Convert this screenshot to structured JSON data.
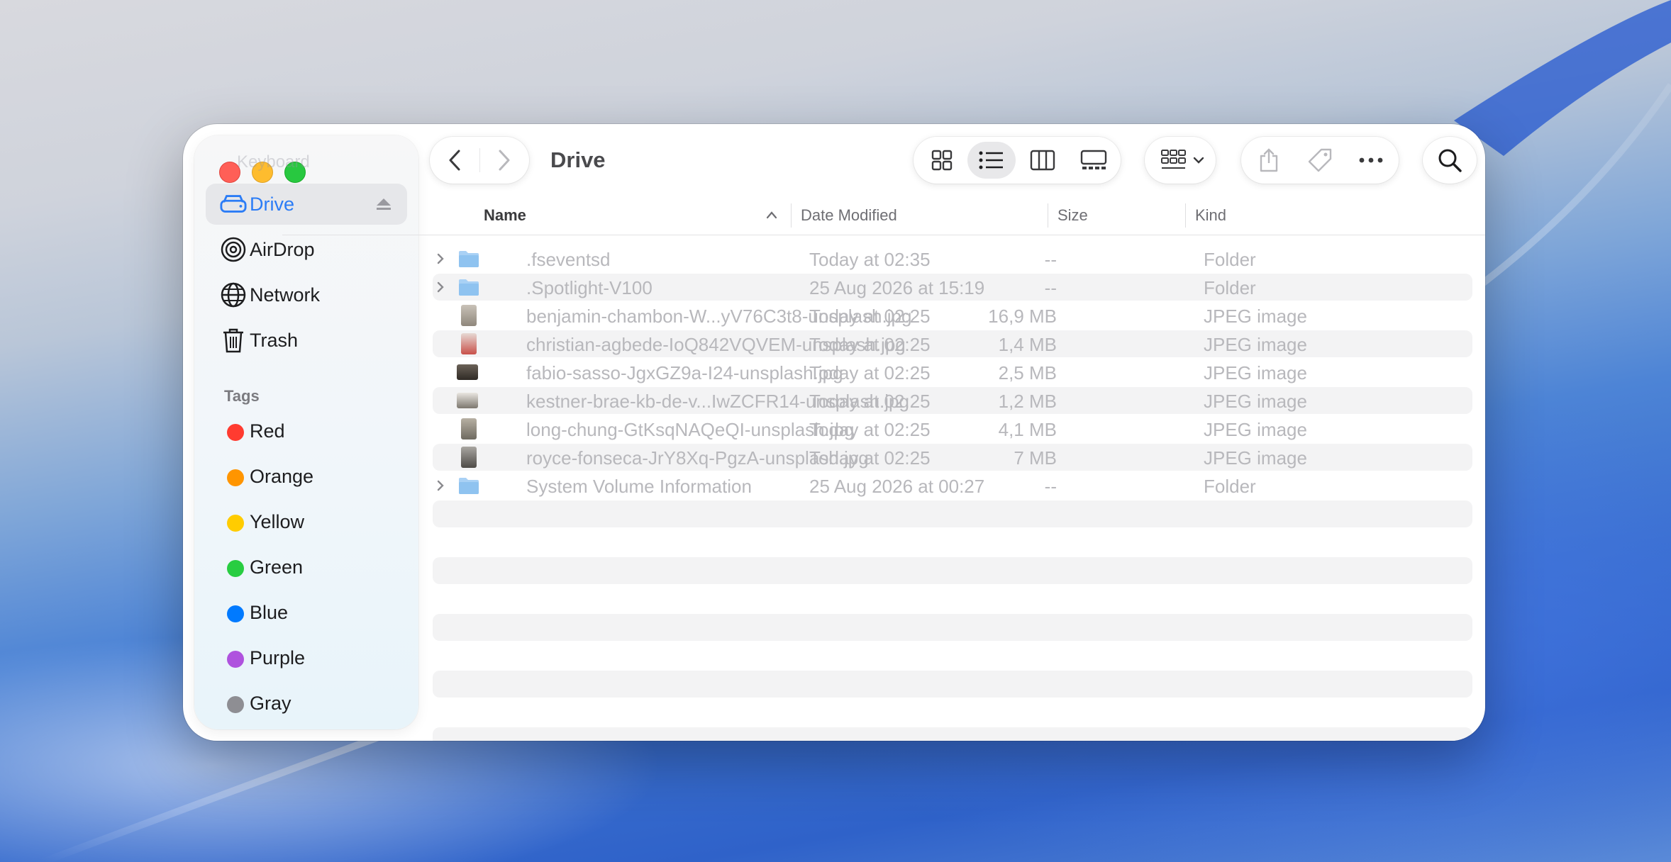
{
  "window": {
    "title": "Drive"
  },
  "sidebar": {
    "ghost_item": "Keyboard",
    "items": [
      {
        "label": "Drive",
        "icon": "external-drive-icon",
        "selected": true
      },
      {
        "label": "AirDrop",
        "icon": "airdrop-icon"
      },
      {
        "label": "Network",
        "icon": "globe-icon"
      },
      {
        "label": "Trash",
        "icon": "trash-icon"
      }
    ],
    "tags_heading": "Tags",
    "tags": [
      {
        "label": "Red",
        "color": "#ff3b30"
      },
      {
        "label": "Orange",
        "color": "#ff9500"
      },
      {
        "label": "Yellow",
        "color": "#ffcc00"
      },
      {
        "label": "Green",
        "color": "#28cd41"
      },
      {
        "label": "Blue",
        "color": "#007aff"
      },
      {
        "label": "Purple",
        "color": "#af52de"
      },
      {
        "label": "Gray",
        "color": "#8e8e93"
      }
    ]
  },
  "columns": {
    "name": "Name",
    "date": "Date Modified",
    "size": "Size",
    "kind": "Kind"
  },
  "files": [
    {
      "name": ".fseventsd",
      "date": "Today at 02:35",
      "size": "--",
      "kind": "Folder",
      "type": "folder"
    },
    {
      "name": ".Spotlight-V100",
      "date": "25 Aug 2026 at 15:19",
      "size": "--",
      "kind": "Folder",
      "type": "folder"
    },
    {
      "name": "benjamin-chambon-W...yV76C3t8-unsplash.jpg",
      "date": "Today at 02:25",
      "size": "16,9 MB",
      "kind": "JPEG image",
      "type": "image"
    },
    {
      "name": "christian-agbede-IoQ842VQVEM-unsplash.jpg",
      "date": "Today at 02:25",
      "size": "1,4 MB",
      "kind": "JPEG image",
      "type": "image"
    },
    {
      "name": "fabio-sasso-JgxGZ9a-I24-unsplash.jpg",
      "date": "Today at 02:25",
      "size": "2,5 MB",
      "kind": "JPEG image",
      "type": "image"
    },
    {
      "name": "kestner-brae-kb-de-v...IwZCFR14-unsplash.jpg",
      "date": "Today at 02:25",
      "size": "1,2 MB",
      "kind": "JPEG image",
      "type": "image"
    },
    {
      "name": "long-chung-GtKsqNAQeQI-unsplash.jpg",
      "date": "Today at 02:25",
      "size": "4,1 MB",
      "kind": "JPEG image",
      "type": "image"
    },
    {
      "name": "royce-fonseca-JrY8Xq-PgzA-unsplash.jpg",
      "date": "Today at 02:25",
      "size": "7 MB",
      "kind": "JPEG image",
      "type": "image"
    },
    {
      "name": "System Volume Information",
      "date": "25 Aug 2026 at 00:27",
      "size": "--",
      "kind": "Folder",
      "type": "folder"
    }
  ],
  "colors": {
    "accent": "#2b7cf6",
    "folder": "#8fc3f0"
  }
}
